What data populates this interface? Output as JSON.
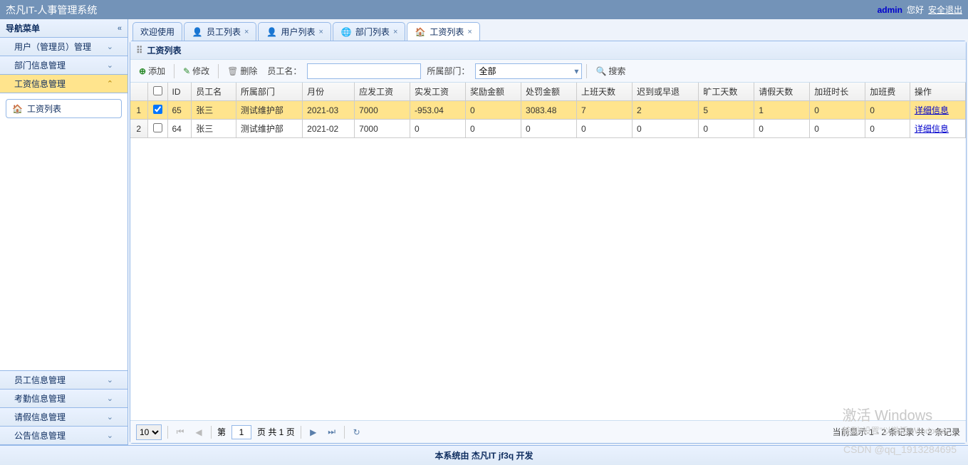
{
  "header": {
    "title": "杰凡IT-人事管理系统",
    "user": "admin",
    "greet": "您好",
    "logout": "安全退出"
  },
  "sidebar": {
    "title": "导航菜单",
    "items": [
      {
        "label": "用户（管理员）管理"
      },
      {
        "label": "部门信息管理"
      },
      {
        "label": "工资信息管理",
        "selected": true
      },
      {
        "label": "员工信息管理"
      },
      {
        "label": "考勤信息管理"
      },
      {
        "label": "请假信息管理"
      },
      {
        "label": "公告信息管理"
      }
    ],
    "sub": {
      "label": "工资列表"
    }
  },
  "tabs": [
    {
      "label": "欢迎使用",
      "closable": false
    },
    {
      "label": "员工列表",
      "closable": true,
      "icon": "user-blue"
    },
    {
      "label": "用户列表",
      "closable": true,
      "icon": "user-red"
    },
    {
      "label": "部门列表",
      "closable": true,
      "icon": "globe"
    },
    {
      "label": "工资列表",
      "closable": true,
      "icon": "home",
      "active": true
    }
  ],
  "panel": {
    "title": "工资列表"
  },
  "toolbar": {
    "add": "添加",
    "edit": "修改",
    "del": "删除",
    "name_label": "员工名：",
    "name_value": "",
    "dept_label": "所属部门：",
    "dept_value": "全部",
    "search": "搜索"
  },
  "columns": [
    "",
    "ID",
    "员工名",
    "所属部门",
    "月份",
    "应发工资",
    "实发工资",
    "奖励金额",
    "处罚金额",
    "上班天数",
    "迟到或早退",
    "旷工天数",
    "请假天数",
    "加班时长",
    "加班费",
    "操作"
  ],
  "rows": [
    {
      "n": 1,
      "checked": true,
      "id": "65",
      "name": "张三",
      "dept": "测试维护部",
      "month": "2021-03",
      "should": "7000",
      "real": "-953.04",
      "reward": "0",
      "penalty": "3083.48",
      "work": "7",
      "late": "2",
      "absent": "5",
      "leave": "1",
      "ot": "0",
      "otpay": "0",
      "op": "详细信息"
    },
    {
      "n": 2,
      "checked": false,
      "id": "64",
      "name": "张三",
      "dept": "测试维护部",
      "month": "2021-02",
      "should": "7000",
      "real": "0",
      "reward": "0",
      "penalty": "0",
      "work": "0",
      "late": "0",
      "absent": "0",
      "leave": "0",
      "ot": "0",
      "otpay": "0",
      "op": "详细信息"
    }
  ],
  "pager": {
    "size": "10",
    "page": "1",
    "page_prefix": "第",
    "page_suffix": "页 共 1 页",
    "info": "当前显示 1 - 2 条记录 共 2 条记录"
  },
  "footer": "本系统由 杰凡IT jf3q 开发",
  "watermark": {
    "line1": "激活 Windows",
    "line2": "转到\"设置\"以激活 Windows。"
  },
  "csdn": "CSDN @qq_1913284695"
}
